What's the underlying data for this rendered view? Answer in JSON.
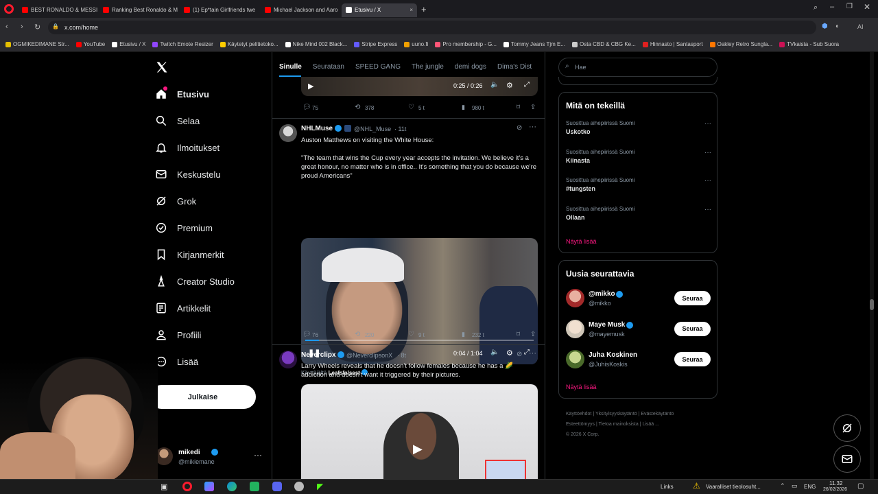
{
  "browser": {
    "tabs": [
      {
        "label": "BEST RONALDO & MESSI",
        "color": "#ff0000"
      },
      {
        "label": "Ranking Best Ronaldo & M",
        "color": "#ff0000"
      },
      {
        "label": "(1) Ep*tain Girlfriends twe",
        "color": "#ff0000"
      },
      {
        "label": "Michael Jackson and Aaro",
        "color": "#ff0000"
      },
      {
        "label": "Etusivu / X",
        "color": "#ffffff"
      }
    ],
    "url": "x.com/home",
    "bookmarks": [
      {
        "label": "OGMIKEDIMANE Str...",
        "color": "#e6c000"
      },
      {
        "label": "YouTube",
        "color": "#ff0000"
      },
      {
        "label": "Etusivu / X",
        "color": "#ffffff"
      },
      {
        "label": "Twitch Emote Resizer",
        "color": "#9146ff"
      },
      {
        "label": "Käytetyt pelitietoko...",
        "color": "#ffcc00"
      },
      {
        "label": "Nike Mind 002 Black...",
        "color": "#ffffff"
      },
      {
        "label": "Stripe Express",
        "color": "#635bff"
      },
      {
        "label": "uuno.fi",
        "color": "#f0a000"
      },
      {
        "label": "Pro membership - G...",
        "color": "#ff5577"
      },
      {
        "label": "Tommy Jeans Tjm E...",
        "color": "#ffffff"
      },
      {
        "label": "Osta CBD & CBG Ke...",
        "color": "#cccccc"
      },
      {
        "label": "Hinnasto | Santasport",
        "color": "#e02020"
      },
      {
        "label": "Oakley Retro Sungla...",
        "color": "#ff7700"
      },
      {
        "label": "TVkaista - Sub Suora",
        "color": "#cc1155"
      }
    ]
  },
  "nav": {
    "items": [
      {
        "label": "Etusivu",
        "icon": "home-icon"
      },
      {
        "label": "Selaa",
        "icon": "search-icon"
      },
      {
        "label": "Ilmoitukset",
        "icon": "bell-icon"
      },
      {
        "label": "Keskustelu",
        "icon": "mail-icon"
      },
      {
        "label": "Grok",
        "icon": "grok-icon"
      },
      {
        "label": "Premium",
        "icon": "verified-icon"
      },
      {
        "label": "Kirjanmerkit",
        "icon": "bookmark-icon"
      },
      {
        "label": "Creator Studio",
        "icon": "studio-icon"
      },
      {
        "label": "Artikkelit",
        "icon": "article-icon"
      },
      {
        "label": "Profiili",
        "icon": "profile-icon"
      },
      {
        "label": "Lisää",
        "icon": "more-icon"
      }
    ],
    "post_button": "Julkaise",
    "account": {
      "name": "mikedi",
      "handle": "@mikiemane"
    }
  },
  "feed": {
    "tabs": [
      "Sinulle",
      "Seurataan",
      "SPEED GANG",
      "The jungle",
      "demi dogs",
      "Dima's Dist"
    ],
    "top_video": {
      "time": "0:25 / 0:26"
    },
    "top_actions": {
      "replies": "75",
      "reposts": "378",
      "likes": "5 t",
      "views": "980 t"
    },
    "tweet1": {
      "name": "NHLMuse",
      "handle": "@NHL_Muse",
      "time": "· 11t",
      "text_line1": "Auston Matthews on visiting the White House:",
      "quote": "\"The team that wins the Cup every year accepts the invitation. We believe it's a great honour, no matter who is in office.. It's something that you do because we're proud Americans\"",
      "video_time": "0:04 / 1:04",
      "video_progress": 0.06,
      "via_prefix": "Käyttäjältä",
      "via_name": "Leafsfalsest",
      "actions": {
        "replies": "76",
        "reposts": "220",
        "likes": "9 t",
        "views": "232 t"
      }
    },
    "tweet2": {
      "name": "Neverclipx",
      "handle": "@NeverclipsonX",
      "time": "· 8t",
      "text": "Larry Wheels reveals that he doesn't follow females because he has a 🌽 addiction and doesn't want it triggered by their pictures."
    }
  },
  "sidebar": {
    "search_placeholder": "Hae",
    "trends_title": "Mitä on tekeillä",
    "trends": [
      {
        "meta": "Suosittua aihepiirissä Suomi",
        "name": "Uskotko"
      },
      {
        "meta": "Suosittua aihepiirissä Suomi",
        "name": "Kiinasta"
      },
      {
        "meta": "Suosittua aihepiirissä Suomi",
        "name": "#tungsten"
      },
      {
        "meta": "Suosittua aihepiirissä Suomi",
        "name": "Ollaan"
      }
    ],
    "show_more": "Näytä lisää",
    "follow_title": "Uusia seurattavia",
    "suggestions": [
      {
        "name": "@mikko",
        "handle": "@mikko",
        "button": "Seuraa"
      },
      {
        "name": "Maye Musk",
        "handle": "@mayemusk",
        "button": "Seuraa"
      },
      {
        "name": "Juha Koskinen",
        "handle": "@JuhisKoskis",
        "button": "Seuraa"
      }
    ],
    "show_more2": "Näytä lisää",
    "footer": {
      "line1": [
        "Käyttöehdot",
        "Yksityisyyskäytäntö",
        "Evästekäytäntö"
      ],
      "line2": [
        "Esteettömyys",
        "Tietoa mainoksista",
        "Lisää ..."
      ],
      "copyright": "© 2026 X Corp."
    }
  },
  "taskbar": {
    "links": "Links",
    "warning": "Vaaralliset tieolosuht...",
    "lang": "ENG",
    "time": "11.32",
    "date": "26/02/2026"
  }
}
